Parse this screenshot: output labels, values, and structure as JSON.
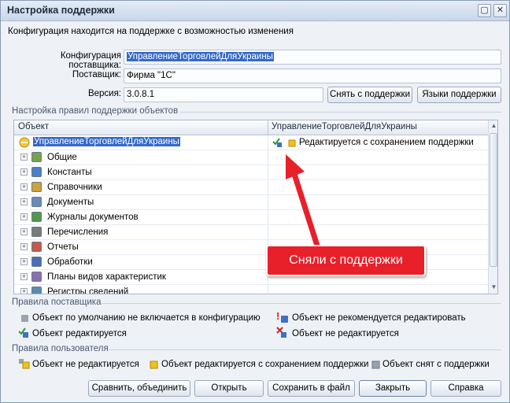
{
  "window": {
    "title": "Настройка поддержки"
  },
  "info": {
    "line": "Конфигурация находится на поддержке с возможностью изменения"
  },
  "form": {
    "vendor_config_label": "Конфигурация поставщика:",
    "vendor_config_value": "УправлениеТорговлейДляУкраины",
    "vendor_label": "Поставщик:",
    "vendor_value": "Фирма \"1С\"",
    "version_label": "Версия:",
    "version_value": "3.0.8.1",
    "remove_support_label": "Снять с поддержки",
    "support_languages_label": "Языки поддержки"
  },
  "rules_group": {
    "title": "Настройка правил поддержки объектов",
    "columns": [
      "Объект",
      "УправлениеТорговлейДляУкраины"
    ],
    "root": {
      "label": "УправлениеТорговлейДляУкраины",
      "status": "Редактируется с сохранением поддержки"
    },
    "items": [
      {
        "label": "Общие",
        "icon": "common-icon"
      },
      {
        "label": "Константы",
        "icon": "constants-icon"
      },
      {
        "label": "Справочники",
        "icon": "catalogs-icon"
      },
      {
        "label": "Документы",
        "icon": "documents-icon"
      },
      {
        "label": "Журналы документов",
        "icon": "document-journals-icon"
      },
      {
        "label": "Перечисления",
        "icon": "enumerations-icon"
      },
      {
        "label": "Отчеты",
        "icon": "reports-icon"
      },
      {
        "label": "Обработки",
        "icon": "data-processors-icon"
      },
      {
        "label": "Планы видов характеристик",
        "icon": "characteristic-types-icon"
      },
      {
        "label": "Регистры сведений",
        "icon": "information-registers-icon"
      }
    ]
  },
  "callout": {
    "text": "Сняли с поддержки"
  },
  "vendor_rules": {
    "title": "Правила поставщика",
    "items": [
      "Объект по умолчанию не включается в конфигурацию",
      "Объект не рекомендуется редактировать",
      "Объект редактируется",
      "Объект не редактируется"
    ]
  },
  "user_rules": {
    "title": "Правила пользователя",
    "items": [
      "Объект не редактируется",
      "Объект редактируется с сохранением поддержки",
      "Объект снят с поддержки"
    ]
  },
  "footer": {
    "compare_label": "Сравнить, объединить",
    "open_label": "Открыть",
    "save_file_label": "Сохранить в файл",
    "close_label": "Закрыть",
    "help_label": "Справка"
  },
  "colors": {
    "callout_red": "#e8202a",
    "selection_blue": "#3569c9",
    "cube_blue": "#3b73c4",
    "cube_yellow": "#f0c21a",
    "cube_gray": "#9aa3ad"
  }
}
